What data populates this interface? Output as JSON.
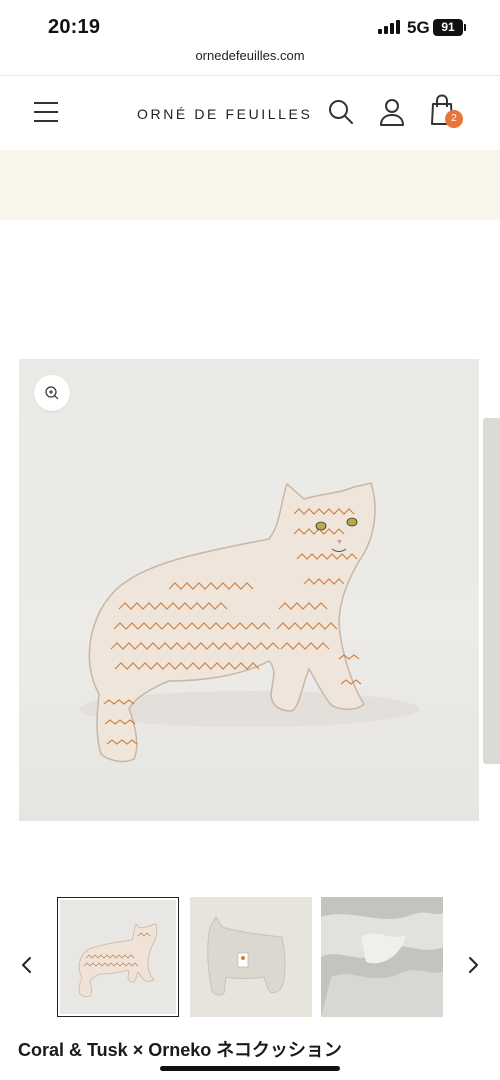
{
  "status_bar": {
    "time": "20:19",
    "network": "5G",
    "battery": "91"
  },
  "browser": {
    "url": "ornedefeuilles.com"
  },
  "header": {
    "logo": "ORNÉ DE FEUILLES",
    "cart_count": "2",
    "icons": [
      "menu-icon",
      "search-icon",
      "account-icon",
      "cart-icon"
    ]
  },
  "colors": {
    "announcement_bg": "#f8f6ea",
    "cart_badge": "#e8763a",
    "cat_stitch": "#c87a3c"
  },
  "gallery": {
    "zoom_icon": "zoom-in-icon",
    "prev_icon": "chevron-left-icon",
    "next_icon": "chevron-right-icon",
    "thumbnail_count": 3,
    "selected_thumbnail": 1
  },
  "product": {
    "title": "Coral & Tusk × Orneko ネコクッション"
  }
}
